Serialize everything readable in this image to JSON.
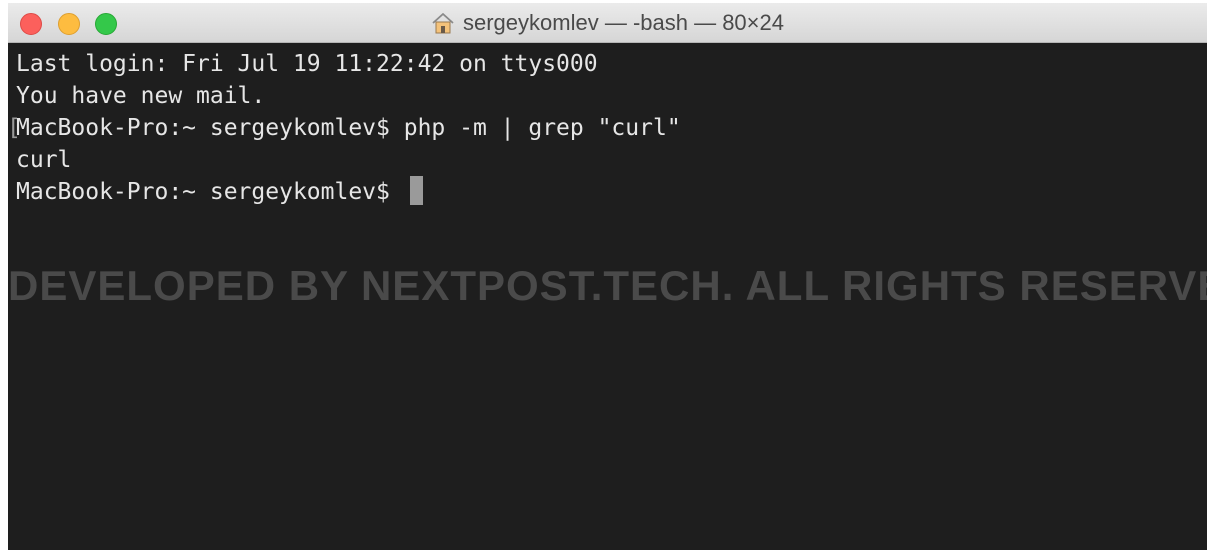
{
  "window": {
    "title": "sergeykomlev — -bash — 80×24",
    "title_icon": "home-icon"
  },
  "terminal": {
    "lines": [
      "Last login: Fri Jul 19 11:22:42 on ttys000",
      "You have new mail.",
      "MacBook-Pro:~ sergeykomlev$ php -m | grep \"curl\"",
      "curl",
      "MacBook-Pro:~ sergeykomlev$ "
    ],
    "bracket_mark": "["
  },
  "watermark": {
    "text": "DEVELOPED BY NEXTPOST.TECH. ALL RIGHTS RESERVED"
  },
  "colors": {
    "background": "#1e1e1e",
    "text": "#e6e6e6",
    "close": "#fc605c",
    "minimize": "#fdbc40",
    "maximize": "#34c84a"
  }
}
